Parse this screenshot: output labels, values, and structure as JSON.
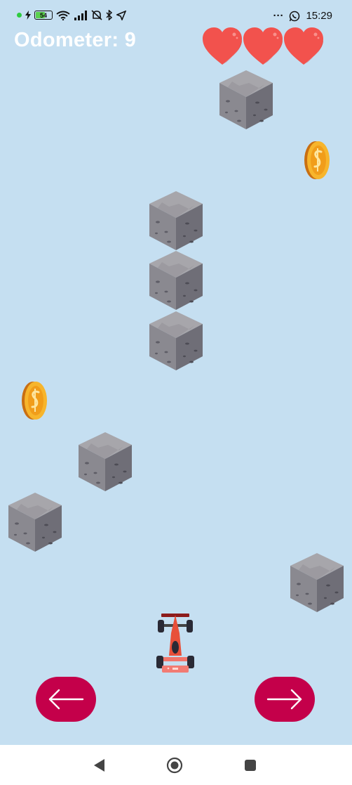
{
  "status_bar": {
    "battery_level": "54",
    "time": "15:29",
    "more_dots": "···",
    "icons": [
      "signal-dot-icon",
      "charging-bolt-icon",
      "battery-icon",
      "wifi-icon",
      "cell-signal-icon",
      "alarm-off-icon",
      "bluetooth-icon",
      "location-arrow-icon",
      "whatsapp-icon"
    ]
  },
  "hud": {
    "odometer_text": "Odometer: 9",
    "lives": 3
  },
  "controls": {
    "left_icon": "left-arrow-icon",
    "right_icon": "right-arrow-icon",
    "button_color": "#c4004a"
  },
  "nav_bar": {
    "icons": [
      "back-triangle-icon",
      "home-circle-icon",
      "recents-square-icon"
    ]
  },
  "colors": {
    "sky": "#c5dff1",
    "heart": "#f2524d",
    "rock": "#8a8a92",
    "coin": "#f0a020",
    "car": "#e8503a"
  }
}
